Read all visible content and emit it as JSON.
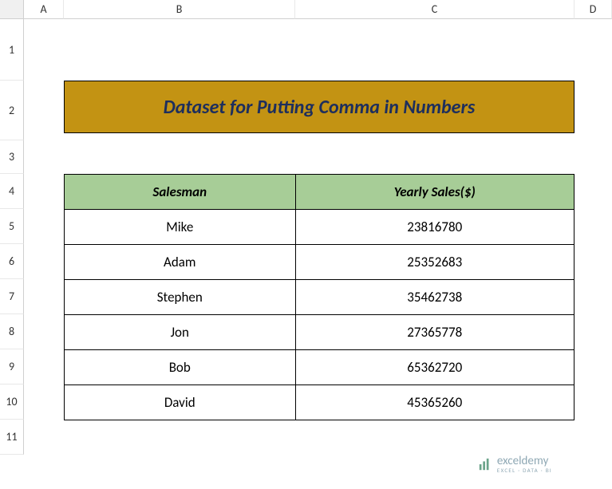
{
  "columns": {
    "A": "A",
    "B": "B",
    "C": "C",
    "D": "D"
  },
  "rows": {
    "1": "1",
    "2": "2",
    "3": "3",
    "4": "4",
    "5": "5",
    "6": "6",
    "7": "7",
    "8": "8",
    "9": "9",
    "10": "10",
    "11": "11"
  },
  "title": "Dataset for Putting Comma in Numbers",
  "headers": {
    "salesman": "Salesman",
    "sales": "Yearly Sales($)"
  },
  "chart_data": {
    "type": "table",
    "columns": [
      "Salesman",
      "Yearly Sales($)"
    ],
    "rows": [
      {
        "salesman": "Mike",
        "sales": "23816780"
      },
      {
        "salesman": "Adam",
        "sales": "25352683"
      },
      {
        "salesman": "Stephen",
        "sales": "35462738"
      },
      {
        "salesman": "Jon",
        "sales": "27365778"
      },
      {
        "salesman": "Bob",
        "sales": "65362720"
      },
      {
        "salesman": "David",
        "sales": "45365260"
      }
    ]
  },
  "watermark": {
    "main": "exceldemy",
    "sub": "EXCEL · DATA · BI"
  }
}
